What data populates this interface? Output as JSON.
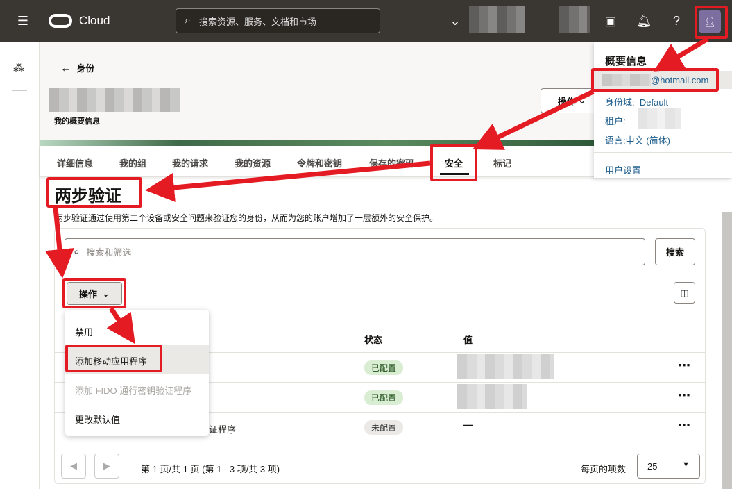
{
  "topbar": {
    "brand": "Cloud",
    "search_placeholder": "搜索资源、服务、文档和市场"
  },
  "header": {
    "back_label": "身份",
    "subtitle": "我的概要信息",
    "actions_label": "操作"
  },
  "tabs": [
    "详细信息",
    "我的组",
    "我的请求",
    "我的资源",
    "令牌和密钥",
    "保存的密码",
    "安全",
    "标记"
  ],
  "active_tab": "安全",
  "section": {
    "title": "两步验证",
    "description": "两步验证通过使用第二个设备或安全问题来验证您的身份，从而为您的账户增加了一层额外的安全保护。"
  },
  "toolbar": {
    "search_placeholder": "搜索和筛选",
    "search_button": "搜索",
    "actions_label": "操作"
  },
  "table": {
    "columns": [
      "状态",
      "值"
    ],
    "rows": [
      {
        "name": "",
        "status": "已配置",
        "value": ""
      },
      {
        "name": "",
        "status": "已配置",
        "value": ""
      },
      {
        "name": "证程序",
        "status": "未配置",
        "value": "—"
      }
    ]
  },
  "menu": {
    "items": [
      {
        "label": "禁用",
        "disabled": false
      },
      {
        "label": "添加移动应用程序",
        "disabled": false,
        "highlighted": true
      },
      {
        "label": "添加 FIDO 通行密钥验证程序",
        "disabled": true
      },
      {
        "label": "更改默认值",
        "disabled": false
      }
    ]
  },
  "pagination": {
    "summary": "第 1 页/共 1 页 (第 1 - 3 项/共 3 项)",
    "per_page_label": "每页的项数",
    "per_page": "25"
  },
  "profile": {
    "title": "概要信息",
    "email": "@hotmail.com",
    "domain_label": "身份域:",
    "domain": "Default",
    "tenant_label": "租户:",
    "language_label": "语言:",
    "language": "中文 (简体)",
    "user_settings": "用户设置"
  },
  "colors": {
    "topbar": "#3a3632",
    "annotation": "#e41b23",
    "link": "#1d5d8c",
    "configured": "#d8edd2"
  }
}
